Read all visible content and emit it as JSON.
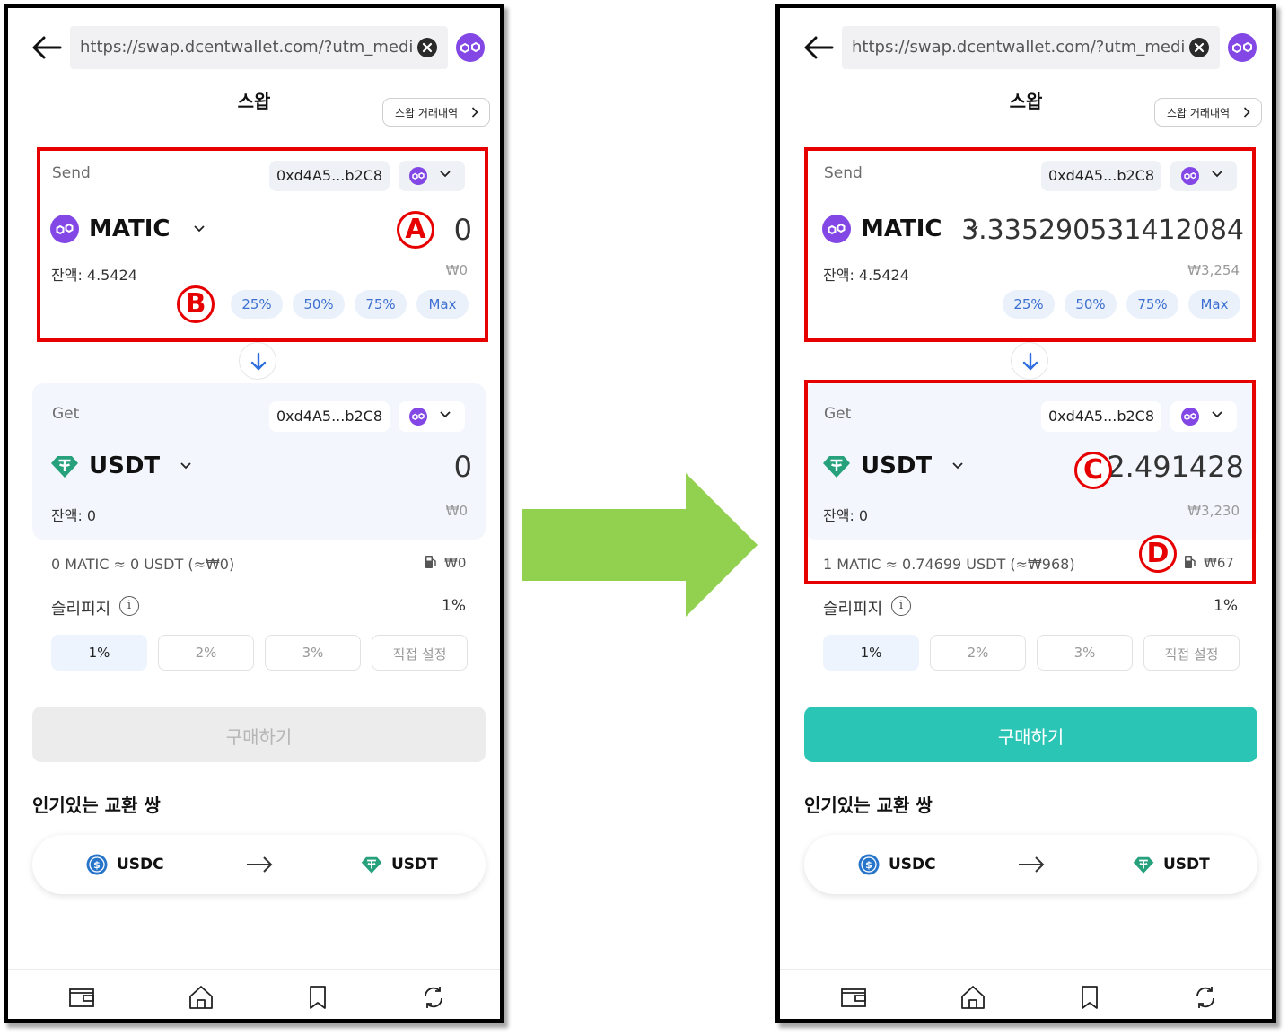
{
  "url_bar": {
    "url": "https://swap.dcentwallet.com/?utm_medium"
  },
  "header": {
    "title": "스왑",
    "history_label": "스왑 거래내역"
  },
  "panels": [
    {
      "send": {
        "label": "Send",
        "address": "0xd4A5...b2C8",
        "token": "MATIC",
        "amount": "0",
        "balance": "잔액: 4.5424",
        "fiat": "₩0",
        "percent_buttons": [
          "25%",
          "50%",
          "75%",
          "Max"
        ]
      },
      "get": {
        "label": "Get",
        "address": "0xd4A5...b2C8",
        "token": "USDT",
        "amount": "0",
        "balance": "잔액: 0",
        "fiat": "₩0"
      },
      "rate": "0 MATIC ≈ 0 USDT (≈₩0)",
      "gas": "₩0",
      "slippage": {
        "label": "슬리피지",
        "value": "1%",
        "options": [
          "1%",
          "2%",
          "3%",
          "직접 설정"
        ],
        "selected": "1%"
      },
      "buy_label": "구매하기",
      "buy_enabled": false,
      "markers": [
        "A",
        "B"
      ]
    },
    {
      "send": {
        "label": "Send",
        "address": "0xd4A5...b2C8",
        "token": "MATIC",
        "amount": "3.335290531412084",
        "balance": "잔액: 4.5424",
        "fiat": "₩3,254",
        "percent_buttons": [
          "25%",
          "50%",
          "75%",
          "Max"
        ]
      },
      "get": {
        "label": "Get",
        "address": "0xd4A5...b2C8",
        "token": "USDT",
        "amount": "2.491428",
        "balance": "잔액: 0",
        "fiat": "₩3,230"
      },
      "rate": "1 MATIC ≈ 0.74699 USDT (≈₩968)",
      "gas": "₩67",
      "slippage": {
        "label": "슬리피지",
        "value": "1%",
        "options": [
          "1%",
          "2%",
          "3%",
          "직접 설정"
        ],
        "selected": "1%"
      },
      "buy_label": "구매하기",
      "buy_enabled": true,
      "markers": [
        "C",
        "D"
      ]
    }
  ],
  "popular": {
    "title": "인기있는 교환 쌍",
    "pair": {
      "from": "USDC",
      "to": "USDT"
    }
  },
  "bottom_nav": [
    "wallet-icon",
    "home-icon",
    "bookmark-icon",
    "swap-refresh-icon"
  ],
  "colors": {
    "matic": "#8247e5",
    "usdt": "#26a17b",
    "usdc": "#2775ca",
    "accent": "#2bc5b5",
    "highlight": "#e60000",
    "arrow": "#92d050"
  }
}
